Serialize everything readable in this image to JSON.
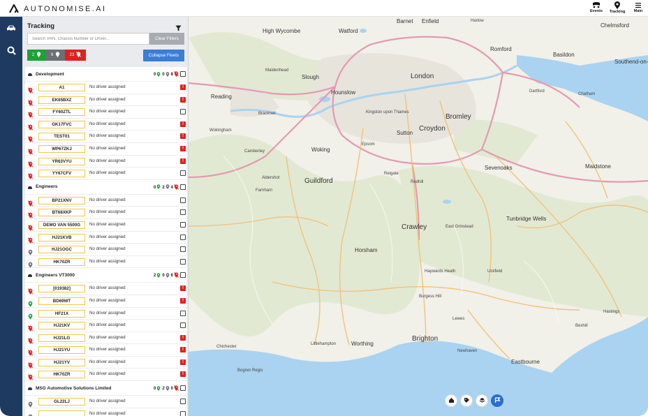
{
  "brand": {
    "name": "AUTONOMISE.AI"
  },
  "topnav": [
    {
      "label": "Events",
      "icon": "events-icon"
    },
    {
      "label": "Tracking",
      "icon": "location-pin-icon"
    },
    {
      "label": "Main",
      "icon": "menu-icon"
    }
  ],
  "rail": {
    "items": [
      {
        "icon": "vehicle-icon"
      },
      {
        "icon": "search-icon"
      }
    ]
  },
  "panel": {
    "title": "Tracking",
    "search_placeholder": "Search VRN, Chassis Number or Driver...",
    "clear_filters": "Clear Filters",
    "collapse_fleets": "Collapse Fleets",
    "status": [
      {
        "count": "2",
        "color": "#1aa336",
        "icon": "pin-icon"
      },
      {
        "count": "9",
        "color": "#6d6f73",
        "icon": "pin-icon"
      },
      {
        "count": "23",
        "color": "#e0201e",
        "icon": "no-signal-icon"
      }
    ]
  },
  "fleets": [
    {
      "name": "Development",
      "counts": [
        "0",
        "0",
        "8"
      ],
      "vehicles": [
        {
          "vrn": "A1",
          "driver": "No driver assigned",
          "state": "red",
          "alert": true
        },
        {
          "vrn": "EK65BXZ",
          "driver": "No driver assigned",
          "state": "red",
          "alert": true
        },
        {
          "vrn": "FY60ZTL",
          "driver": "No driver assigned",
          "state": "red",
          "alert": false
        },
        {
          "vrn": "GK17FVC",
          "driver": "No driver assigned",
          "state": "red",
          "alert": true
        },
        {
          "vrn": "TEST01",
          "driver": "No driver assigned",
          "state": "red",
          "alert": true
        },
        {
          "vrn": "WP67ZKJ",
          "driver": "No driver assigned",
          "state": "red",
          "alert": true
        },
        {
          "vrn": "YR63VYU",
          "driver": "No driver assigned",
          "state": "red",
          "alert": true
        },
        {
          "vrn": "YY67CFV",
          "driver": "No driver assigned",
          "state": "red",
          "alert": false
        }
      ]
    },
    {
      "name": "Engineers",
      "counts": [
        "0",
        "2",
        "4"
      ],
      "vehicles": [
        {
          "vrn": "BP21XNV",
          "driver": "No driver assigned",
          "state": "red",
          "alert": false
        },
        {
          "vrn": "BT68XKP",
          "driver": "No driver assigned",
          "state": "red",
          "alert": false
        },
        {
          "vrn": "DEMO VAN 5500G",
          "driver": "No driver assigned",
          "state": "red",
          "alert": false
        },
        {
          "vrn": "HJ21KVB",
          "driver": "No driver assigned",
          "state": "red",
          "alert": false
        },
        {
          "vrn": "HJ21OGC",
          "driver": "No driver assigned",
          "state": "grey",
          "alert": false
        },
        {
          "vrn": "HK70ZR",
          "driver": "No driver assigned",
          "state": "grey",
          "alert": false
        }
      ]
    },
    {
      "name": "Engineers VT3000",
      "counts": [
        "2",
        "0",
        "6"
      ],
      "vehicles": [
        {
          "vrn": "[019382]",
          "driver": "No driver assigned",
          "state": "red",
          "alert": true
        },
        {
          "vrn": "BD69WT",
          "driver": "No driver assigned",
          "state": "green",
          "alert": true
        },
        {
          "vrn": "HF21X",
          "driver": "No driver assigned",
          "state": "green",
          "alert": false
        },
        {
          "vrn": "HJ21KV",
          "driver": "No driver assigned",
          "state": "red",
          "alert": false
        },
        {
          "vrn": "HJ21LG",
          "driver": "No driver assigned",
          "state": "red",
          "alert": true
        },
        {
          "vrn": "HJ21YU",
          "driver": "No driver assigned",
          "state": "red",
          "alert": true
        },
        {
          "vrn": "HJ21YV",
          "driver": "No driver assigned",
          "state": "red",
          "alert": true
        },
        {
          "vrn": "HK70ZR",
          "driver": "No driver assigned",
          "state": "red",
          "alert": true
        }
      ]
    },
    {
      "name": "MSG Automotive Solutions Limited",
      "counts": [
        "0",
        "2",
        "0"
      ],
      "vehicles": [
        {
          "vrn": "GL22LJ",
          "driver": "No driver assigned",
          "state": "grey",
          "alert": false
        },
        {
          "vrn": "",
          "driver": "No driver assigned",
          "state": "grey",
          "alert": false
        }
      ]
    }
  ],
  "map": {
    "places_big": [
      "London",
      "Croydon",
      "Bromley",
      "Guildford",
      "Crawley",
      "Brighton",
      "Eastbourne",
      "Worthing",
      "Reading",
      "Slough",
      "Horsham",
      "Maidstone",
      "Tunbridge Wells",
      "Chelmsford"
    ],
    "places_mid": [
      "Barnet",
      "Enfield",
      "High Wycombe",
      "Watford",
      "Harlow",
      "Romford",
      "Basildon",
      "Southend-on-Sea",
      "Hounslow",
      "Kingston upon Thames",
      "Sutton",
      "Epsom",
      "Woking",
      "Aldershot",
      "Farnham",
      "Dartford",
      "Chatham",
      "Sevenoaks",
      "Haywards Heath",
      "Bognor Regis",
      "Hastings",
      "Bexhill",
      "Uckfield",
      "Lewes",
      "Newhaven",
      "Littlehampton",
      "Bracknell",
      "Maidenhead",
      "Wokingham",
      "Camberley",
      "Reigate",
      "Redhill",
      "East Grinstead",
      "Burgess Hill",
      "Chichester"
    ],
    "buttons": [
      {
        "icon": "home-icon",
        "active": false
      },
      {
        "icon": "tag-icon",
        "active": false
      },
      {
        "icon": "layers-icon",
        "active": false
      },
      {
        "icon": "geofence-icon",
        "active": true
      }
    ]
  }
}
